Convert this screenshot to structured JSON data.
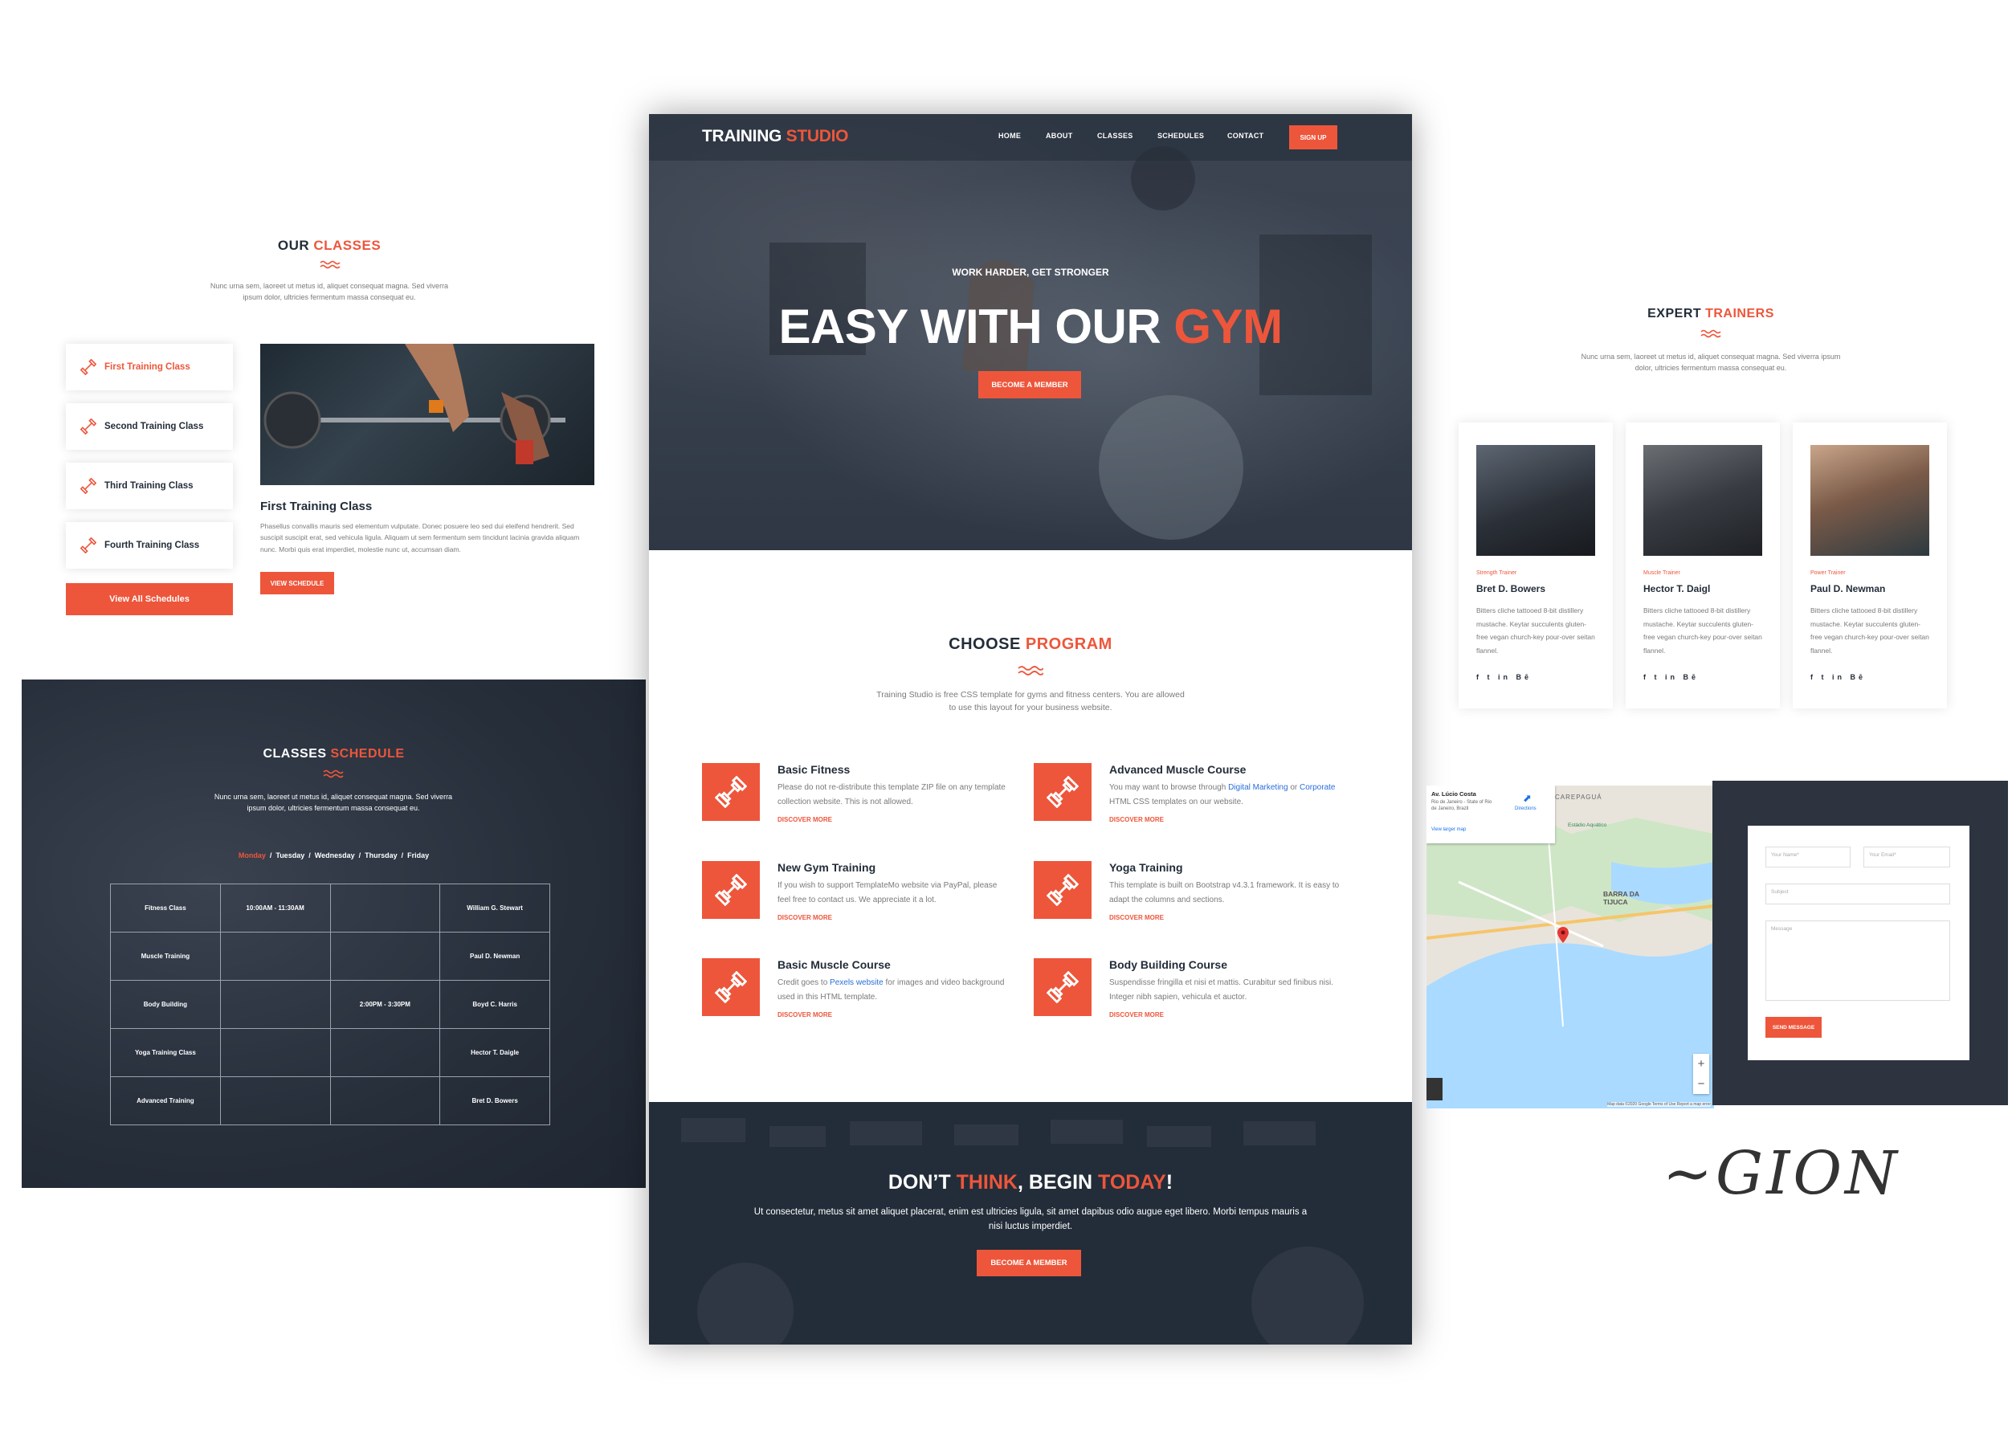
{
  "classes": {
    "title_a": "OUR",
    "title_b": "CLASSES",
    "subtitle": "Nunc urna sem, laoreet ut metus id, aliquet consequat magna. Sed viverra ipsum dolor, ultricies fermentum massa consequat eu.",
    "items": [
      "First Training Class",
      "Second Training Class",
      "Third Training Class",
      "Fourth Training Class"
    ],
    "view_all": "View All Schedules",
    "detail_title": "First Training Class",
    "detail_text": "Phasellus convallis mauris sed elementum vulputate. Donec posuere leo sed dui eleifend hendrerit. Sed suscipit suscipit erat, sed vehicula ligula. Aliquam ut sem fermentum sem tincidunt lacinia gravida aliquam nunc. Morbi quis erat imperdiet, molestie nunc ut, accumsan diam.",
    "detail_button": "VIEW SCHEDULE"
  },
  "schedule": {
    "title_a": "CLASSES",
    "title_b": "SCHEDULE",
    "subtitle": "Nunc urna sem, laoreet ut metus id, aliquet consequat magna. Sed viverra ipsum dolor, ultricies fermentum massa consequat eu.",
    "days": [
      "Monday",
      "Tuesday",
      "Wednesday",
      "Thursday",
      "Friday"
    ],
    "rows": [
      [
        "Fitness Class",
        "10:00AM - 11:30AM",
        "",
        "William G. Stewart"
      ],
      [
        "Muscle Training",
        "",
        "",
        "Paul D. Newman"
      ],
      [
        "Body Building",
        "",
        "2:00PM - 3:30PM",
        "Boyd C. Harris"
      ],
      [
        "Yoga Training Class",
        "",
        "",
        "Hector T. Daigle"
      ],
      [
        "Advanced Training",
        "",
        "",
        "Bret D. Bowers"
      ]
    ]
  },
  "site": {
    "logo_a": "TRAINING",
    "logo_b": "STUDIO",
    "nav": [
      "HOME",
      "ABOUT",
      "CLASSES",
      "SCHEDULES",
      "CONTACT"
    ],
    "signup": "SIGN UP",
    "hero_kicker": "WORK HARDER, GET STRONGER",
    "hero_title_a": "EASY WITH OUR",
    "hero_title_b": "GYM",
    "hero_button": "BECOME A MEMBER",
    "program_title_a": "CHOOSE",
    "program_title_b": "PROGRAM",
    "program_subtitle": "Training Studio is free CSS template for gyms and fitness centers. You are allowed to use this layout for your business website.",
    "programs": [
      {
        "title": "Basic Fitness",
        "text": "Please do not re-distribute this template ZIP file on any template collection website. This is not allowed.",
        "link": "DISCOVER MORE"
      },
      {
        "title": "Advanced Muscle Course",
        "text_a": "You may want to browse through ",
        "link_a": "Digital Marketing",
        "text_b": " or ",
        "link_b": "Corporate",
        "text_c": " HTML CSS templates on our website.",
        "link": "DISCOVER MORE"
      },
      {
        "title": "New Gym Training",
        "text": "If you wish to support TemplateMo website via PayPal, please feel free to contact us. We appreciate it a lot.",
        "link": "DISCOVER MORE"
      },
      {
        "title": "Yoga Training",
        "text": "This template is built on Bootstrap v4.3.1 framework. It is easy to adapt the columns and sections.",
        "link": "DISCOVER MORE"
      },
      {
        "title": "Basic Muscle Course",
        "text_a": "Credit goes to ",
        "link_a": "Pexels website",
        "text_b": " for images and video background used in this HTML template.",
        "link": "DISCOVER MORE"
      },
      {
        "title": "Body Building Course",
        "text": "Suspendisse fringilla et nisi et mattis. Curabitur sed finibus nisi. Integer nibh sapien, vehicula et auctor.",
        "link": "DISCOVER MORE"
      }
    ],
    "cta_a": "DON’T",
    "cta_b": "THINK",
    "cta_c": ", BEGIN",
    "cta_d": "TODAY",
    "cta_e": "!",
    "cta_text": "Ut consectetur, metus sit amet aliquet placerat, enim est ultricies ligula, sit amet dapibus odio augue eget libero. Morbi tempus mauris a nisi luctus imperdiet.",
    "cta_button": "BECOME A MEMBER"
  },
  "trainers": {
    "title_a": "EXPERT",
    "title_b": "TRAINERS",
    "subtitle": "Nunc urna sem, laoreet ut metus id, aliquet consequat magna. Sed viverra ipsum dolor, ultricies fermentum massa consequat eu.",
    "list": [
      {
        "role": "Strength Trainer",
        "name": "Bret D. Bowers",
        "text": "Bitters cliche tattooed 8-bit distillery mustache. Keytar succulents gluten-free vegan church-key pour-over seitan flannel.",
        "social": "f  t  in  Bē"
      },
      {
        "role": "Muscle Trainer",
        "name": "Hector T. Daigl",
        "text": "Bitters cliche tattooed 8-bit distillery mustache. Keytar succulents gluten-free vegan church-key pour-over seitan flannel.",
        "social": "f  t  in  Bē"
      },
      {
        "role": "Power Trainer",
        "name": "Paul D. Newman",
        "text": "Bitters cliche tattooed 8-bit distillery mustache. Keytar succulents gluten-free vegan church-key pour-over seitan flannel.",
        "social": "f  t  in  Bē"
      }
    ]
  },
  "contact": {
    "map_place": "Av. Lúcio Costa",
    "map_addr": "Rio de Janeiro - State of Rio de Janeiro, Brazil",
    "map_directions": "Directions",
    "map_larger": "View larger map",
    "map_labels": [
      "CAREPAGUÁ",
      "BARRA DA TIJUCA",
      "Estádio Aquático"
    ],
    "map_footer": "Map data ©2020 Google   Terms of Use   Report a map error",
    "zoom_in": "+",
    "zoom_out": "−",
    "name_ph": "Your Name*",
    "email_ph": "Your Email*",
    "subject_ph": "Subject",
    "message_ph": "Message",
    "send": "SEND MESSAGE"
  },
  "signature": "~GION",
  "colors": {
    "accent": "#ed563b",
    "dark": "#232d39"
  }
}
